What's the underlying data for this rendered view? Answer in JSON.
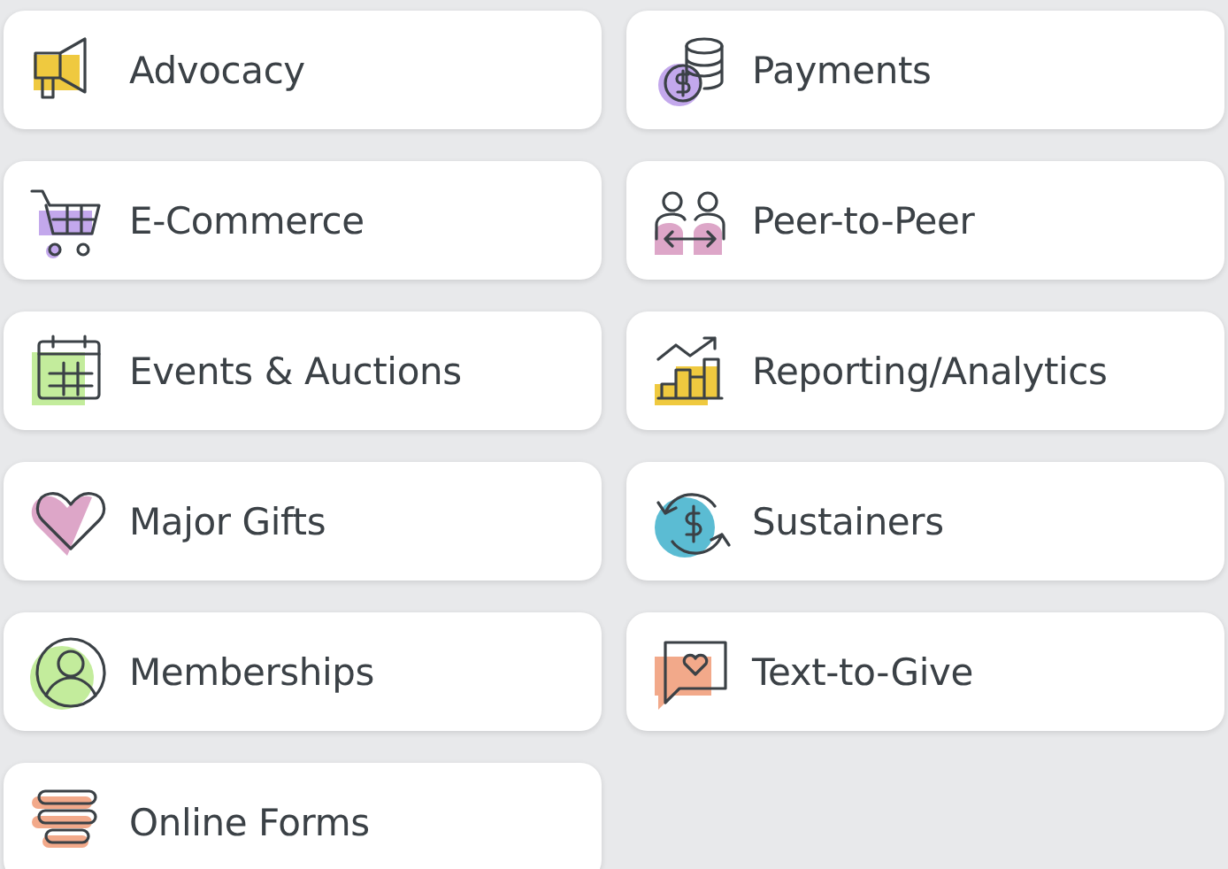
{
  "tiles": [
    {
      "label": "Advocacy",
      "kind": "megaphone",
      "color": "#efc93f"
    },
    {
      "label": "Payments",
      "kind": "coins",
      "color": "#c3a8ec"
    },
    {
      "label": "E-Commerce",
      "kind": "cart",
      "color": "#c3a8ec"
    },
    {
      "label": "Peer-to-Peer",
      "kind": "people",
      "color": "#dda6c8"
    },
    {
      "label": "Events & Auctions",
      "kind": "calendar",
      "color": "#c3ec9c"
    },
    {
      "label": "Reporting/Analytics",
      "kind": "chart",
      "color": "#efc93f"
    },
    {
      "label": "Major Gifts",
      "kind": "heart",
      "color": "#dda6c8"
    },
    {
      "label": "Sustainers",
      "kind": "cycle",
      "color": "#5bbcd3"
    },
    {
      "label": "Memberships",
      "kind": "person",
      "color": "#c3ec9c"
    },
    {
      "label": "Text-to-Give",
      "kind": "message",
      "color": "#f2a98a"
    },
    {
      "label": "Online Forms",
      "kind": "forms",
      "color": "#f2a98a"
    }
  ]
}
